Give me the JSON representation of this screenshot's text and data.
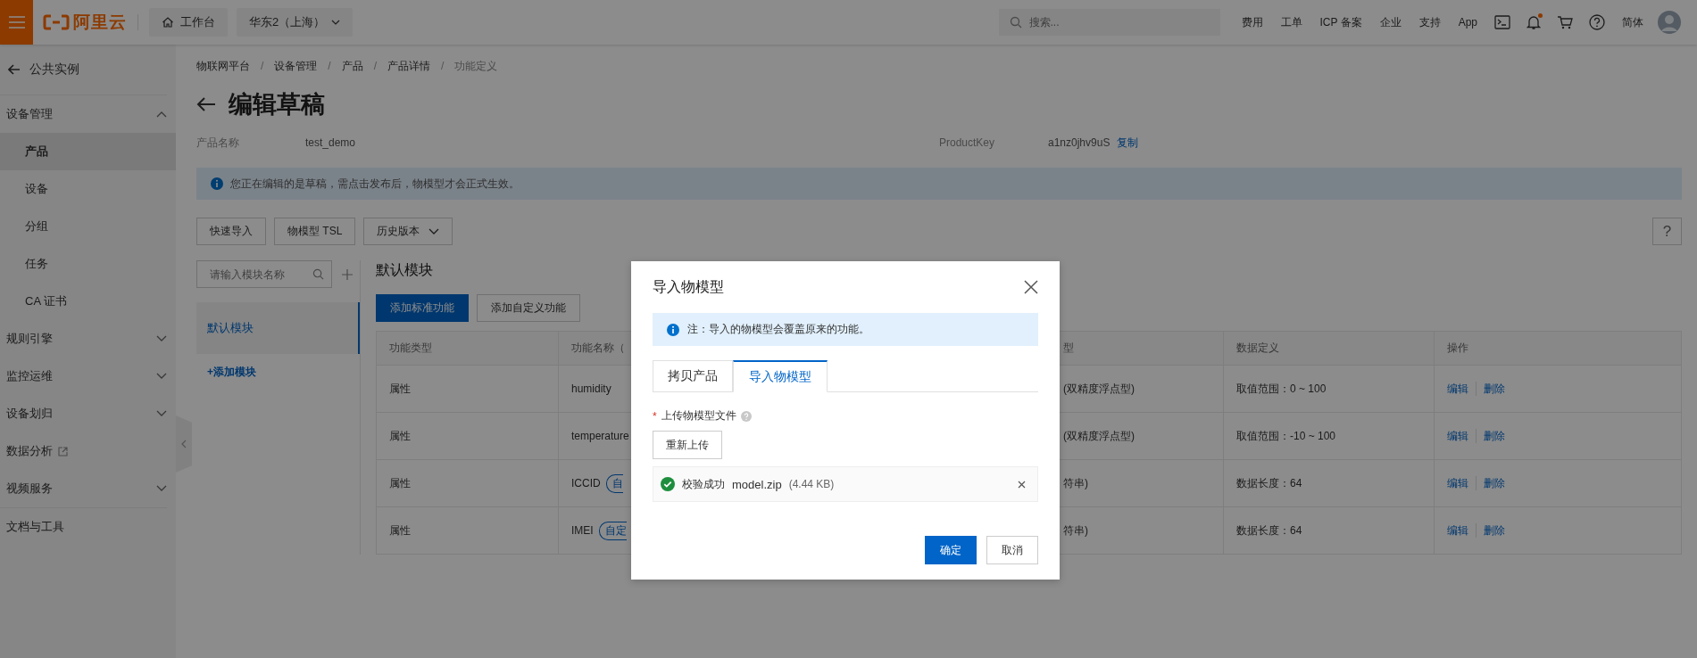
{
  "top_bar": {
    "logo_text": "阿里云",
    "workbench": "工作台",
    "region": "华东2（上海）",
    "search": {
      "placeholder": "搜索..."
    },
    "links": [
      "费用",
      "工单",
      "ICP 备案",
      "企业",
      "支持",
      "App"
    ],
    "notification_dot": true,
    "language": "简体"
  },
  "sidebar": {
    "back": "公共实例",
    "groups": [
      {
        "kind": "group",
        "label": "设备管理",
        "expanded": true,
        "items": [
          {
            "label": "产品",
            "selected": true
          },
          {
            "label": "设备",
            "selected": false
          },
          {
            "label": "分组",
            "selected": false
          },
          {
            "label": "任务",
            "selected": false
          },
          {
            "label": "CA 证书",
            "selected": false
          }
        ]
      },
      {
        "kind": "group",
        "label": "规则引擎",
        "expanded": false
      },
      {
        "kind": "group",
        "label": "监控运维",
        "expanded": false
      },
      {
        "kind": "group",
        "label": "设备划归",
        "expanded": false
      },
      {
        "kind": "external",
        "label": "数据分析"
      },
      {
        "kind": "group",
        "label": "视频服务",
        "expanded": false
      }
    ],
    "footer": "文档与工具"
  },
  "breadcrumb": [
    "物联网平台",
    "设备管理",
    "产品",
    "产品详情",
    "功能定义"
  ],
  "breadcrumb_separator": "/",
  "help_button": "?",
  "page": {
    "title": "编辑草稿",
    "fields": [
      {
        "label": "产品名称",
        "value": "test_demo"
      },
      {
        "label": "ProductKey",
        "value": "a1nz0jhv9uS",
        "action": "复制"
      }
    ],
    "notice": "您正在编辑的是草稿，需点击发布后，物模型才会正式生效。",
    "toolbar": [
      {
        "kind": "button",
        "label": "快速导入"
      },
      {
        "kind": "button",
        "label": "物模型 TSL"
      },
      {
        "kind": "dropdown",
        "label": "历史版本"
      }
    ]
  },
  "modules": {
    "search": {
      "placeholder": "请输入模块名称"
    },
    "items": [
      {
        "label": "默认模块",
        "selected": true
      }
    ],
    "add": "+添加模块"
  },
  "content": {
    "heading": "默认模块",
    "buttons": [
      {
        "kind": "primary",
        "label": "添加标准功能"
      },
      {
        "kind": "default",
        "label": "添加自定义功能"
      }
    ],
    "table": {
      "columns": [
        "功能类型",
        "功能名称（",
        "",
        "型",
        "数据定义",
        "操作"
      ],
      "rows": [
        {
          "type": "属性",
          "name": "humidity",
          "column_3": "(双精度浮点型)",
          "definition": "取值范围：0 ~ 100",
          "actions": [
            "编辑",
            "删除"
          ]
        },
        {
          "type": "属性",
          "name": "temperature",
          "column_3": "(双精度浮点型)",
          "definition": "取值范围：-10 ~ 100",
          "actions": [
            "编辑",
            "删除"
          ]
        },
        {
          "type": "属性",
          "name": "ICCID",
          "tag": "自",
          "column_3": "符串)",
          "definition": "数据长度：64",
          "actions": [
            "编辑",
            "删除"
          ]
        },
        {
          "type": "属性",
          "name": "IMEI",
          "tag": "自定",
          "column_3": "符串)",
          "definition": "数据长度：64",
          "actions": [
            "编辑",
            "删除"
          ]
        }
      ]
    }
  },
  "dialog": {
    "title": "导入物模型",
    "notice": "注：导入的物模型会覆盖原来的功能。",
    "tabs": [
      {
        "label": "拷贝产品",
        "selected": false
      },
      {
        "label": "导入物模型",
        "selected": true
      }
    ],
    "field_label": "上传物模型文件",
    "required": true,
    "required_mark": "*",
    "reupload": "重新上传",
    "file": {
      "valid": true,
      "status": "校验成功",
      "name": "model.zip",
      "size": "(4.44 KB)"
    },
    "buttons": [
      {
        "kind": "primary",
        "label": "确定"
      },
      {
        "kind": "default",
        "label": "取消"
      }
    ]
  }
}
